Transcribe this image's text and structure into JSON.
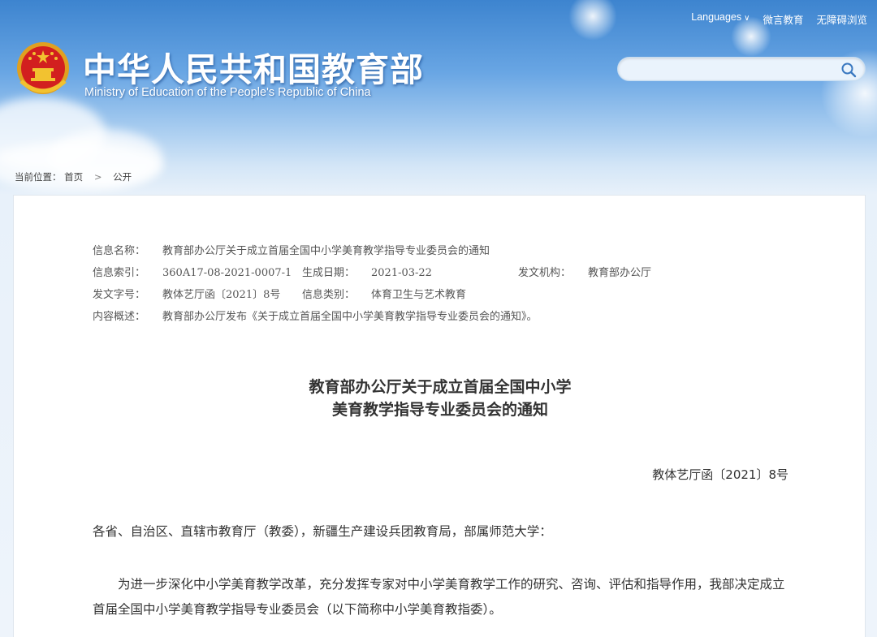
{
  "header": {
    "site_title_cn": "中华人民共和国教育部",
    "site_title_en": "Ministry of Education of the People's Republic of China",
    "top_links": {
      "languages": "Languages",
      "weiyan": "微言教育",
      "accessibility": "无障碍浏览"
    },
    "search": {
      "placeholder": ""
    }
  },
  "breadcrumb": {
    "prefix": "当前位置：",
    "home": "首页",
    "separator": ">",
    "current": "公开"
  },
  "meta": {
    "name_label": "信息名称：",
    "name_value": "教育部办公厅关于成立首届全国中小学美育教学指导专业委员会的通知",
    "index_label": "信息索引：",
    "index_value": "360A17-08-2021-0007-1",
    "date_label": "生成日期：",
    "date_value": "2021-03-22",
    "org_label": "发文机构：",
    "org_value": "教育部办公厅",
    "docno_label": "发文字号：",
    "docno_value": "教体艺厅函〔2021〕8号",
    "category_label": "信息类别：",
    "category_value": "体育卫生与艺术教育",
    "summary_label": "内容概述：",
    "summary_value": "教育部办公厅发布《关于成立首届全国中小学美育教学指导专业委员会的通知》。"
  },
  "document": {
    "title_line1": "教育部办公厅关于成立首届全国中小学",
    "title_line2": "美育教学指导专业委员会的通知",
    "number": "教体艺厅函〔2021〕8号",
    "salutation": "各省、自治区、直辖市教育厅（教委），新疆生产建设兵团教育局，部属师范大学：",
    "paragraph1": "为进一步深化中小学美育教学改革，充分发挥专家对中小学美育教学工作的研究、咨询、评估和指导作用，我部决定成立首届全国中小学美育教学指导专业委员会（以下简称中小学美育教指委）。"
  },
  "colors": {
    "header_blue": "#3d84cf",
    "panel_bg": "#ffffff",
    "emblem_red": "#d21f1f",
    "emblem_gold": "#f2c230"
  }
}
